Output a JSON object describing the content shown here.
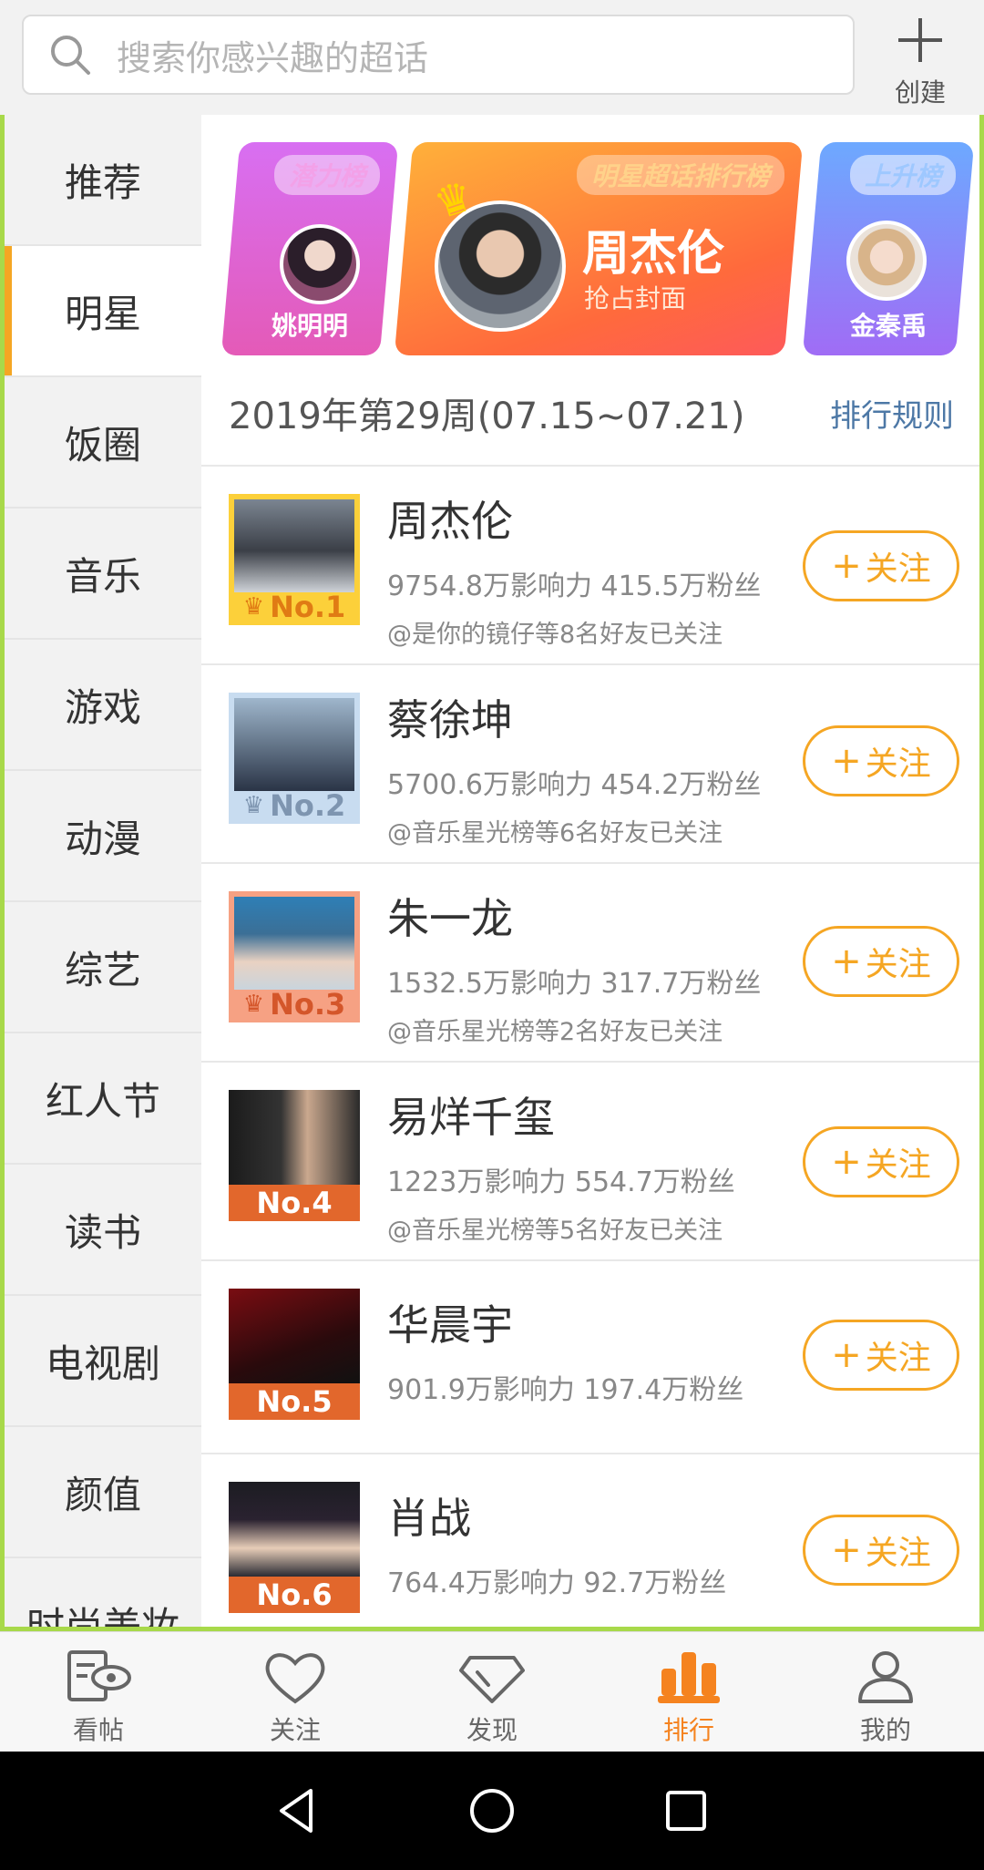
{
  "search": {
    "placeholder": "搜索你感兴趣的超话",
    "create_label": "创建"
  },
  "sidebar": {
    "items": [
      {
        "label": "推荐"
      },
      {
        "label": "明星"
      },
      {
        "label": "饭圈"
      },
      {
        "label": "音乐"
      },
      {
        "label": "游戏"
      },
      {
        "label": "动漫"
      },
      {
        "label": "综艺"
      },
      {
        "label": "红人节"
      },
      {
        "label": "读书"
      },
      {
        "label": "电视剧"
      },
      {
        "label": "颜值"
      },
      {
        "label": "时尚美妆"
      }
    ],
    "active": "明星"
  },
  "banner": {
    "left": {
      "tag": "潜力榜",
      "name": "姚明明"
    },
    "middle": {
      "tag": "明星超话排行榜",
      "name": "周杰伦",
      "subtitle": "抢占封面"
    },
    "right": {
      "tag": "上升榜",
      "name": "金秦禹"
    }
  },
  "week": {
    "label": "2019年第29周(07.15~07.21)",
    "rules_link": "排行规则"
  },
  "follow_label": "关注",
  "ranking": [
    {
      "rank": "No.1",
      "name": "周杰伦",
      "stats": "9754.8万影响力 415.5万粉丝",
      "friends": "@是你的镜仔等8名好友已关注"
    },
    {
      "rank": "No.2",
      "name": "蔡徐坤",
      "stats": "5700.6万影响力 454.2万粉丝",
      "friends": "@音乐星光榜等6名好友已关注"
    },
    {
      "rank": "No.3",
      "name": "朱一龙",
      "stats": "1532.5万影响力 317.7万粉丝",
      "friends": "@音乐星光榜等2名好友已关注"
    },
    {
      "rank": "No.4",
      "name": "易烊千玺",
      "stats": "1223万影响力 554.7万粉丝",
      "friends": "@音乐星光榜等5名好友已关注"
    },
    {
      "rank": "No.5",
      "name": "华晨宇",
      "stats": "901.9万影响力 197.4万粉丝",
      "friends": ""
    },
    {
      "rank": "No.6",
      "name": "肖战",
      "stats": "764.4万影响力 92.7万粉丝",
      "friends": ""
    }
  ],
  "tabs": [
    {
      "label": "看帖",
      "icon": "eye-post-icon"
    },
    {
      "label": "关注",
      "icon": "heart-icon"
    },
    {
      "label": "发现",
      "icon": "diamond-icon"
    },
    {
      "label": "排行",
      "icon": "bar-chart-icon"
    },
    {
      "label": "我的",
      "icon": "person-icon"
    }
  ],
  "colors": {
    "accent": "#f5a623",
    "active_tab": "#f5831f",
    "link": "#4d78a6",
    "frame": "#a8d94a"
  }
}
